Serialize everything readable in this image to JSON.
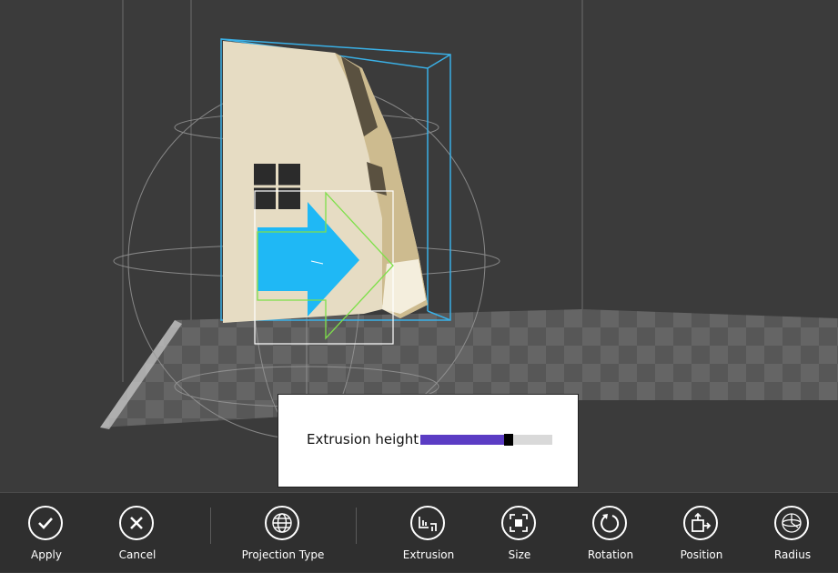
{
  "popup": {
    "label": "Extrusion height",
    "value_fraction": 0.67
  },
  "toolbar": {
    "apply": "Apply",
    "cancel": "Cancel",
    "projection_type": "Projection Type",
    "extrusion": "Extrusion",
    "size": "Size",
    "rotation": "Rotation",
    "position": "Position",
    "radius": "Radius"
  },
  "colors": {
    "slider_fill": "#5b3cc4",
    "arrow_blue": "#1fb8f5",
    "bounding_box": "#3ab0e6",
    "highlight_green": "#7ee04a",
    "model_beige": "#e6dcc3"
  }
}
